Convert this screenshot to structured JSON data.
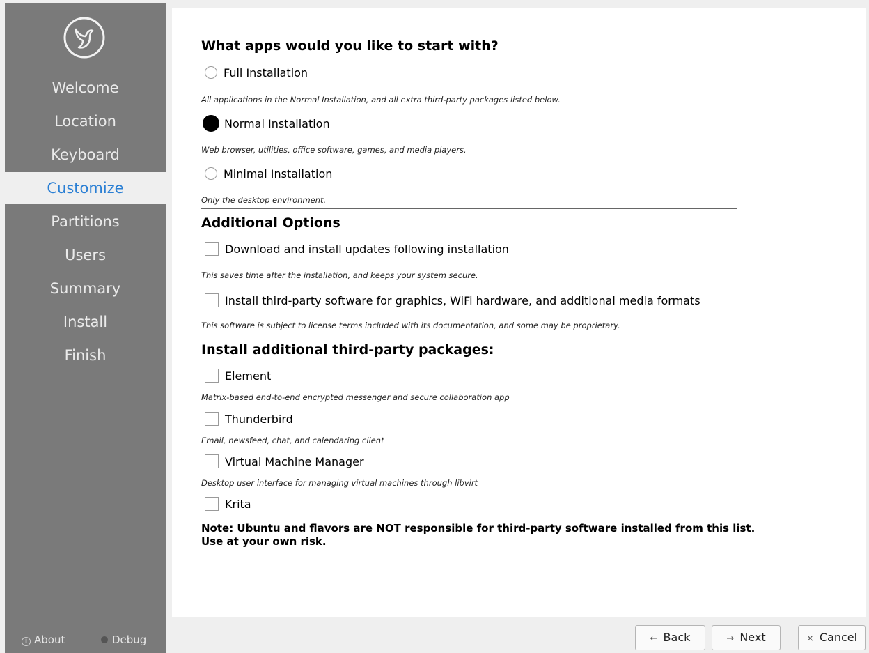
{
  "sidebar": {
    "items": [
      {
        "label": "Welcome",
        "active": false
      },
      {
        "label": "Location",
        "active": false
      },
      {
        "label": "Keyboard",
        "active": false
      },
      {
        "label": "Customize",
        "active": true
      },
      {
        "label": "Partitions",
        "active": false
      },
      {
        "label": "Users",
        "active": false
      },
      {
        "label": "Summary",
        "active": false
      },
      {
        "label": "Install",
        "active": false
      },
      {
        "label": "Finish",
        "active": false
      }
    ],
    "about_label": "About",
    "debug_label": "Debug"
  },
  "apps": {
    "heading": "What apps would you like to start with?",
    "options": [
      {
        "label": "Full Installation",
        "description": "All applications in the Normal Installation, and all extra third-party packages listed below.",
        "selected": false
      },
      {
        "label": "Normal Installation",
        "description": "Web browser, utilities, office software, games, and media players.",
        "selected": true
      },
      {
        "label": "Minimal Installation",
        "description": "Only the desktop environment.",
        "selected": false
      }
    ]
  },
  "additional": {
    "heading": "Additional Options",
    "options": [
      {
        "label": "Download and install updates following installation",
        "description": "This saves time after the installation, and keeps your system secure.",
        "checked": false
      },
      {
        "label": "Install third-party software for graphics, WiFi hardware, and additional media formats",
        "description": "This software is subject to license terms included with its documentation, and some may be proprietary.",
        "checked": false
      }
    ]
  },
  "packages": {
    "heading": "Install additional third-party packages:",
    "items": [
      {
        "label": "Element",
        "description": "Matrix-based end-to-end encrypted messenger and secure collaboration app",
        "checked": false
      },
      {
        "label": "Thunderbird",
        "description": "Email, newsfeed, chat, and calendaring client",
        "checked": false
      },
      {
        "label": "Virtual Machine Manager",
        "description": "Desktop user interface for managing virtual machines through libvirt",
        "checked": false
      },
      {
        "label": "Krita",
        "description": "",
        "checked": false
      }
    ],
    "note_line1": "Note: Ubuntu and flavors are NOT responsible for third-party software installed from this list.",
    "note_line2": "Use at your own risk."
  },
  "buttons": {
    "back": "Back",
    "next": "Next",
    "cancel": "Cancel",
    "back_icon": "←",
    "next_icon": "→",
    "cancel_icon": "×"
  },
  "colors": {
    "sidebar_bg": "#7a7a7a",
    "active_text": "#2a7fd4"
  }
}
